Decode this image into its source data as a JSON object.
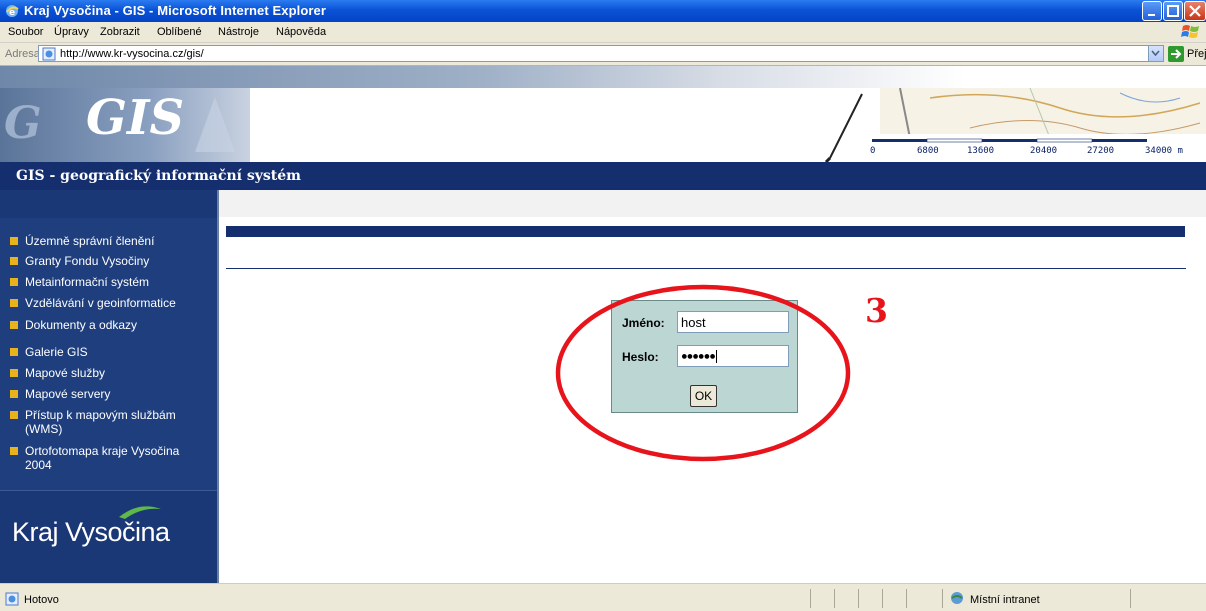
{
  "window": {
    "title": "Kraj Vysočina - GIS - Microsoft Internet Explorer"
  },
  "menu": {
    "items": [
      "Soubor",
      "Úpravy",
      "Zobrazit",
      "Oblíbené",
      "Nástroje",
      "Nápověda"
    ]
  },
  "address": {
    "label": "Adresa",
    "url": "http://www.kr-vysocina.cz/gis/",
    "go_label": "Přejít"
  },
  "header": {
    "logo_text": "GIS",
    "subtitle": "GIS - geografický informační systém",
    "scale_ticks": [
      "0",
      "6800",
      "13600",
      "20400",
      "27200",
      "34000 m"
    ]
  },
  "sidebar": {
    "items": [
      "Územně správní členění",
      "Granty Fondu Vysočiny",
      "Metainformační systém",
      "Vzdělávání v geoinformatice",
      "Dokumenty a odkazy",
      "Galerie GIS",
      "Mapové služby",
      "Mapové servery",
      "Přístup k mapovým službám",
      "(WMS)",
      "Ortofotomapa kraje Vysočina",
      "2004"
    ],
    "brand": "Kraj Vysočina"
  },
  "login": {
    "name_label": "Jméno:",
    "name_value": "host",
    "password_label": "Heslo:",
    "password_value": "●●●●●●",
    "ok_label": "OK"
  },
  "annotation": {
    "step": "3",
    "color": "#e8141b"
  },
  "status": {
    "text": "Hotovo",
    "zone": "Místní intranet"
  },
  "colors": {
    "navy": "#142e6e",
    "sidebar": "#1e3e7d",
    "bullet": "#e7b21b",
    "login_bg": "#bcd6d4"
  }
}
